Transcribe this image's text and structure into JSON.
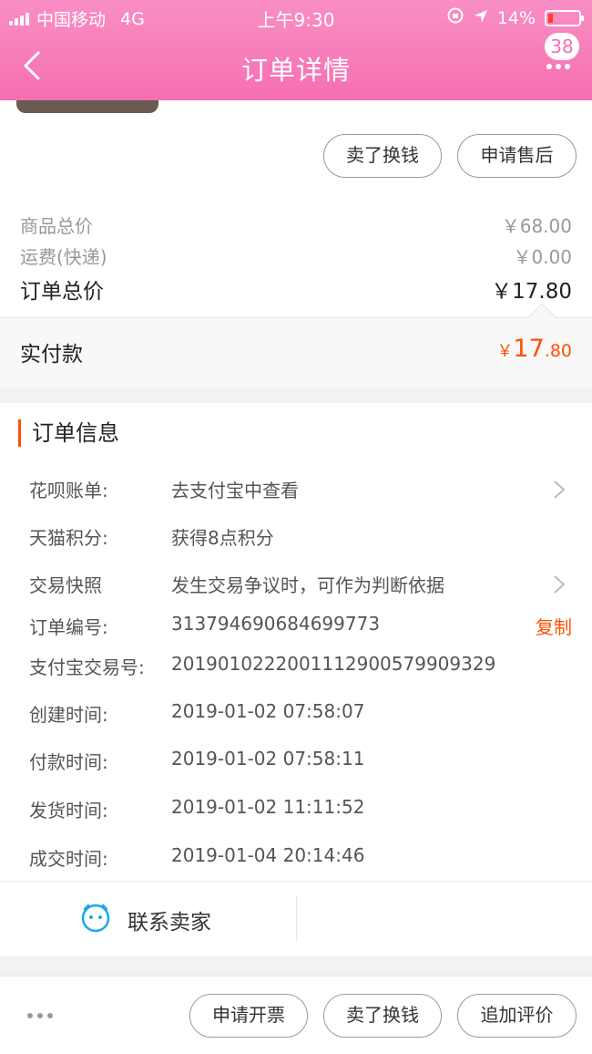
{
  "status_bar": {
    "carrier": "中国移动",
    "network": "4G",
    "time": "上午9:30",
    "battery": "14%"
  },
  "header": {
    "title": "订单详情",
    "badge_count": "38",
    "back_icon": "chevron-left-icon",
    "more_icon": "more-dots-icon"
  },
  "actions_top": {
    "sell_label": "卖了换钱",
    "after_sale_label": "申请售后"
  },
  "pricing": {
    "goods_total_label": "商品总价",
    "goods_total_value": "￥68.00",
    "shipping_label": "运费(快递)",
    "shipping_value": "￥0.00",
    "order_total_label": "订单总价",
    "order_total_value": "￥17.80",
    "paid_label": "实付款",
    "paid_currency": "￥",
    "paid_integer": "17",
    "paid_decimal": ".80"
  },
  "order_info": {
    "title": "订单信息",
    "rows": [
      {
        "key": "花呗账单:",
        "value": "去支付宝中查看"
      },
      {
        "key": "天猫积分:",
        "value": "获得8点积分"
      },
      {
        "key": "交易快照",
        "value": "发生交易争议时，可作为判断依据"
      },
      {
        "key": "订单编号:",
        "value": "313794690684699773"
      },
      {
        "key": "支付宝交易号:",
        "value": "2019010222001112900579909329"
      },
      {
        "key": "创建时间:",
        "value": "2019-01-02 07:58:07"
      },
      {
        "key": "付款时间:",
        "value": "2019-01-02 07:58:11"
      },
      {
        "key": "发货时间:",
        "value": "2019-01-02 11:11:52"
      },
      {
        "key": "成交时间:",
        "value": "2019-01-04 20:14:46"
      }
    ],
    "copy_label": "复制"
  },
  "contact": {
    "label": "联系卖家",
    "icon": "chat-face-icon"
  },
  "bottom_bar": {
    "invoice_label": "申请开票",
    "sell_label": "卖了换钱",
    "review_label": "追加评价"
  },
  "colors": {
    "header_pink": "#f56fb2",
    "accent_orange": "#ff5000"
  }
}
